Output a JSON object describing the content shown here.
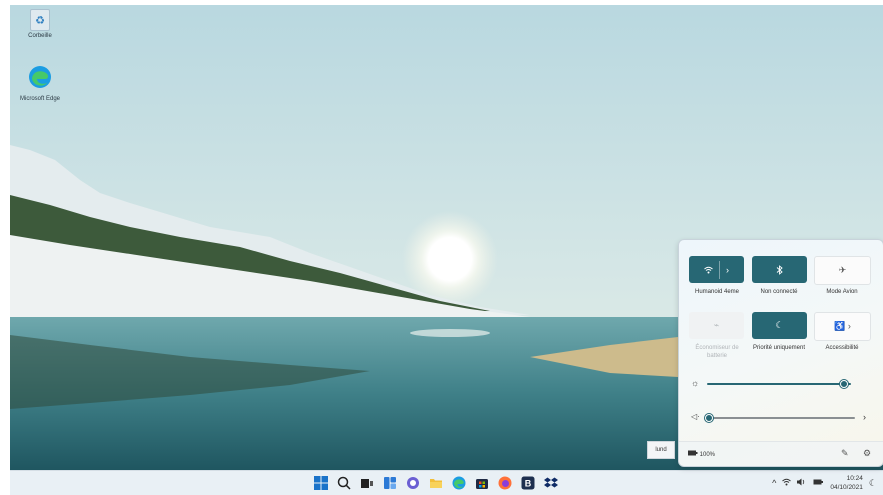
{
  "desktop": {
    "icons": [
      {
        "label": "Corbeille"
      },
      {
        "label": "Microsoft Edge"
      }
    ]
  },
  "quick_settings": {
    "tiles": [
      {
        "label": "Humanoid 4eme",
        "state": "on",
        "icon": "wifi-icon"
      },
      {
        "label": "Non connecté",
        "state": "on",
        "icon": "bluetooth-icon"
      },
      {
        "label": "Mode Avion",
        "state": "off",
        "icon": "airplane-icon"
      },
      {
        "label": "Économiseur de batterie",
        "state": "disabled",
        "icon": "battery-saver-icon"
      },
      {
        "label": "Priorité uniquement",
        "state": "on",
        "icon": "moon-icon"
      },
      {
        "label": "Accessibilité",
        "state": "off",
        "icon": "accessibility-icon"
      }
    ],
    "brightness": 0.95,
    "volume": 0.0,
    "battery_text": "100%"
  },
  "language_button": "lund",
  "taskbar": {
    "apps": [
      "start-icon",
      "search-icon",
      "task-view-icon",
      "widgets-icon",
      "chat-icon",
      "file-explorer-icon",
      "edge-icon",
      "store-icon",
      "firefox-icon",
      "app-b-icon",
      "dropbox-icon"
    ],
    "time": "10:24",
    "date": "04/10/2021"
  },
  "colors": {
    "accent": "#276774",
    "taskbar": "#e9f0f5"
  }
}
